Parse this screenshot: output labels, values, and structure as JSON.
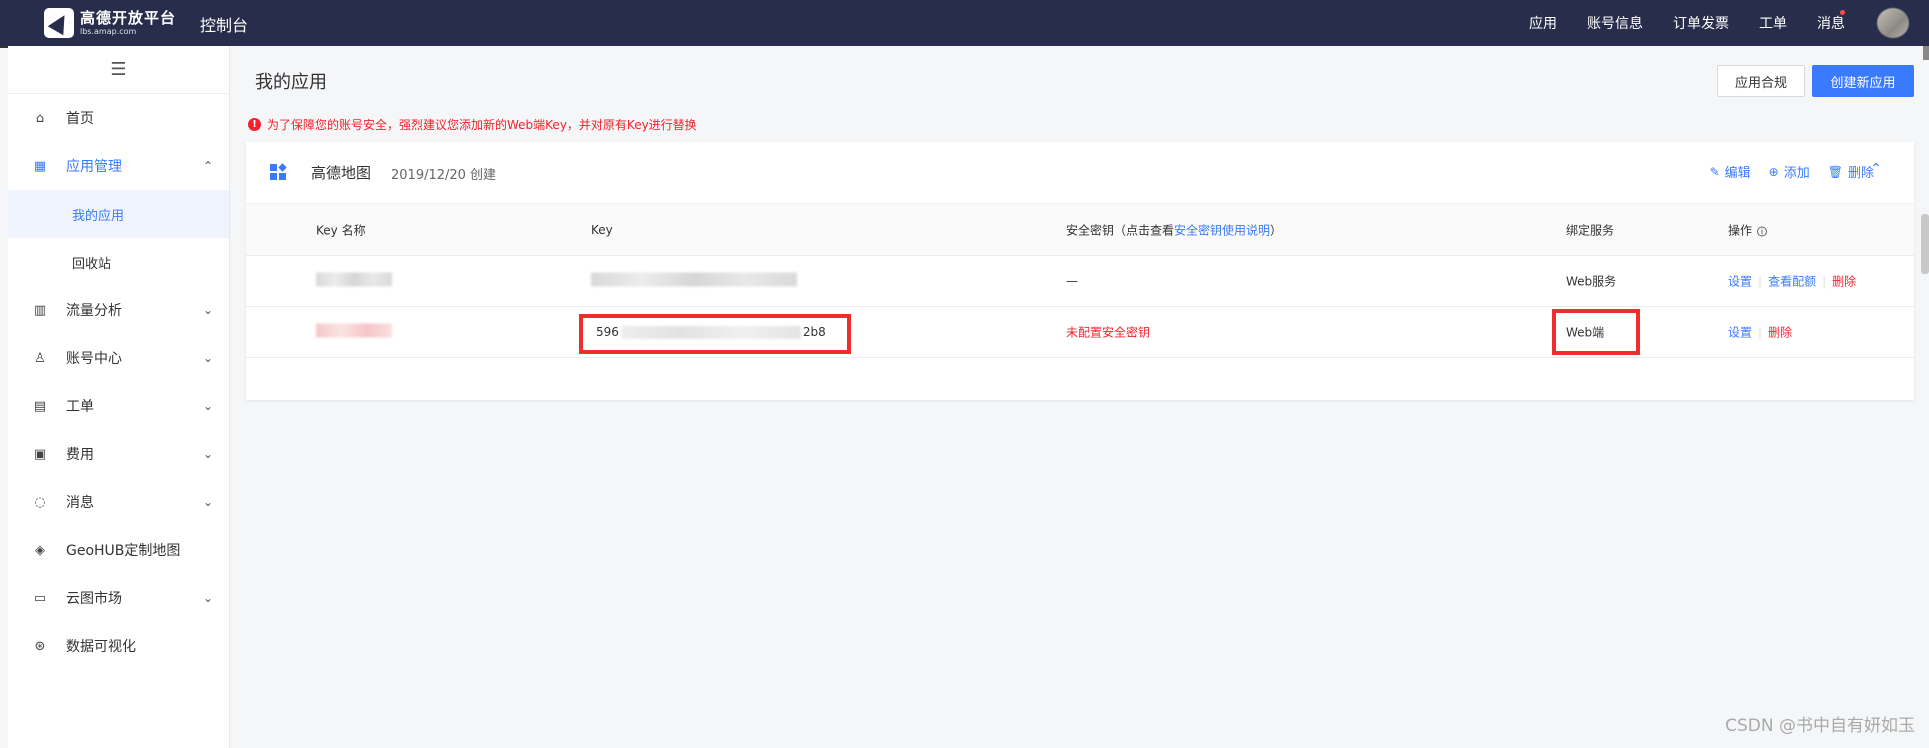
{
  "topbar": {
    "logo_title": "高德开放平台",
    "logo_subtitle": "lbs.amap.com",
    "console_title": "控制台",
    "nav": [
      "应用",
      "账号信息",
      "订单发票",
      "工单",
      "消息"
    ]
  },
  "sidebar": {
    "menu_icon": "hamburger-icon",
    "items": [
      {
        "label": "首页",
        "icon": "home-icon"
      },
      {
        "label": "应用管理",
        "icon": "grid-icon",
        "expanded": true,
        "children": [
          "我的应用",
          "回收站"
        ]
      },
      {
        "label": "流量分析",
        "icon": "chart-icon"
      },
      {
        "label": "账号中心",
        "icon": "user-icon"
      },
      {
        "label": "工单",
        "icon": "ticket-icon"
      },
      {
        "label": "费用",
        "icon": "bill-icon"
      },
      {
        "label": "消息",
        "icon": "message-icon"
      },
      {
        "label": "GeoHUB定制地图",
        "icon": "layers-icon"
      },
      {
        "label": "云图市场",
        "icon": "store-icon"
      },
      {
        "label": "数据可视化",
        "icon": "visual-icon"
      }
    ]
  },
  "main": {
    "title": "我的应用",
    "compliance_button": "应用合规",
    "create_button": "创建新应用",
    "warning": "为了保障您的账号安全，强烈建议您添加新的Web端Key，并对原有Key进行替换"
  },
  "app_card": {
    "name": "高德地图",
    "created": "2019/12/20 创建",
    "actions": {
      "edit": "编辑",
      "add": "添加",
      "delete": "删除"
    },
    "columns": {
      "key_name": "Key 名称",
      "key": "Key",
      "secret_prefix": "安全密钥（点击查看",
      "secret_link": "安全密钥使用说明",
      "secret_suffix": "）",
      "service": "绑定服务",
      "ops": "操作"
    },
    "rows": [
      {
        "secret": "—",
        "service": "Web服务",
        "ops": [
          "设置",
          "查看配额",
          "删除"
        ]
      },
      {
        "key_start": "596",
        "key_end": "2b8",
        "secret": "未配置安全密钥",
        "service": "Web端",
        "ops": [
          "设置",
          "删除"
        ]
      }
    ]
  },
  "watermark": "CSDN @书中自有妍如玉"
}
